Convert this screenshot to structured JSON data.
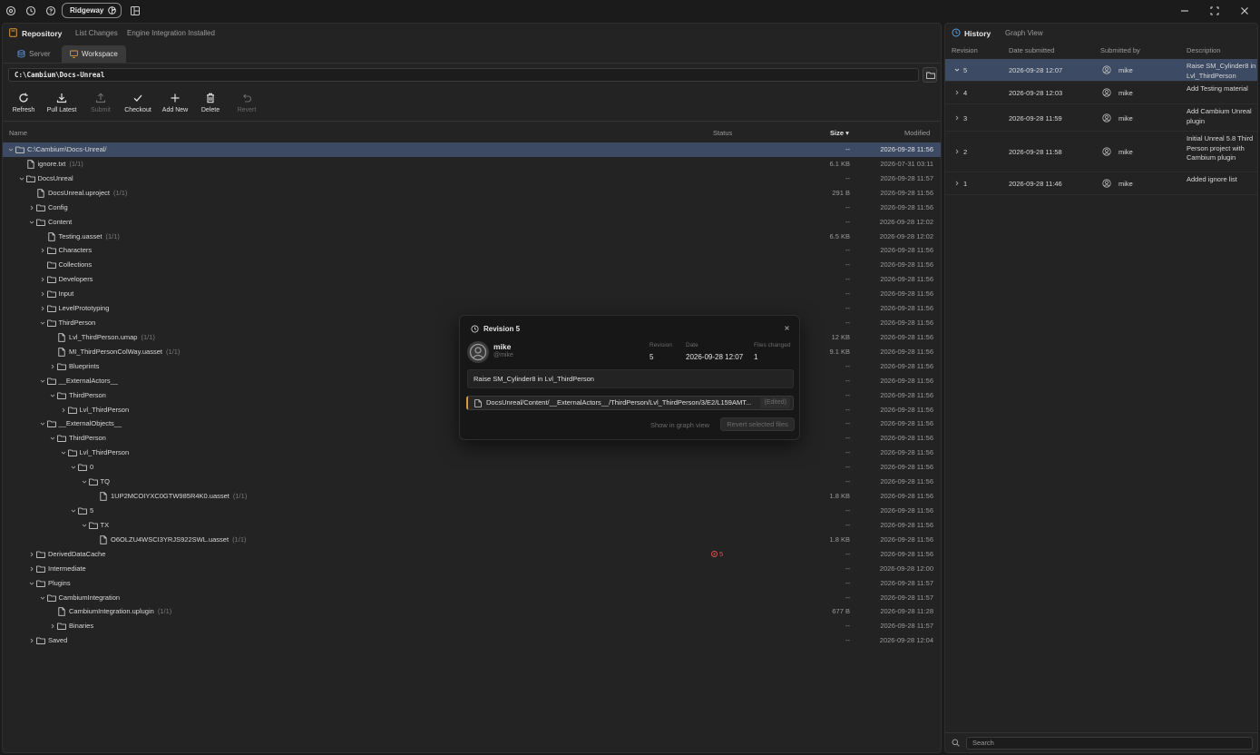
{
  "titlebar": {
    "project_name": "Ridgeway"
  },
  "left_panel": {
    "header": {
      "title": "Repository",
      "tabs": [
        "List Changes",
        "Engine Integration Installed"
      ]
    },
    "subtabs": {
      "server": "Server",
      "workspace": "Workspace",
      "active": "Workspace"
    },
    "path": "C:\\Cambium\\Docs-Unreal",
    "toolbar": {
      "refresh": "Refresh",
      "pull_latest": "Pull Latest",
      "submit": "Submit",
      "checkout": "Checkout",
      "add_new": "Add New",
      "delete": "Delete",
      "revert": "Revert"
    },
    "columns": {
      "name": "Name",
      "status": "Status",
      "size": "Size ▾",
      "modified": "Modified"
    },
    "tree": [
      {
        "name": "C:\\Cambium\\Docs-Unreal/",
        "rev": "",
        "size": "--",
        "modified": "2026-09-28 11:56",
        "type": "folder",
        "depth": 0,
        "expanded": true,
        "selected": true,
        "status": ""
      },
      {
        "name": "ignore.txt",
        "rev": "(1/1)",
        "size": "6.1 KB",
        "modified": "2026-07-31 03:11",
        "type": "file",
        "depth": 1,
        "status": ""
      },
      {
        "name": "DocsUnreal",
        "rev": "",
        "size": "--",
        "modified": "2026-09-28 11:57",
        "type": "folder",
        "depth": 1,
        "expanded": true,
        "status": ""
      },
      {
        "name": "DocsUnreal.uproject",
        "rev": "(1/1)",
        "size": "291 B",
        "modified": "2026-09-28 11:56",
        "type": "file",
        "depth": 2,
        "status": ""
      },
      {
        "name": "Config",
        "rev": "",
        "size": "--",
        "modified": "2026-09-28 11:56",
        "type": "folder",
        "depth": 2,
        "expanded": false,
        "status": ""
      },
      {
        "name": "Content",
        "rev": "",
        "size": "--",
        "modified": "2026-09-28 12:02",
        "type": "folder",
        "depth": 2,
        "expanded": true,
        "status": ""
      },
      {
        "name": "Testing.uasset",
        "rev": "(1/1)",
        "size": "6.5 KB",
        "modified": "2026-09-28 12:02",
        "type": "file",
        "depth": 3,
        "status": ""
      },
      {
        "name": "Characters",
        "rev": "",
        "size": "--",
        "modified": "2026-09-28 11:56",
        "type": "folder",
        "depth": 3,
        "expanded": false,
        "status": ""
      },
      {
        "name": "Collections",
        "rev": "",
        "size": "--",
        "modified": "2026-09-28 11:56",
        "type": "folder",
        "depth": 3,
        "expanded": null,
        "status": ""
      },
      {
        "name": "Developers",
        "rev": "",
        "size": "--",
        "modified": "2026-09-28 11:56",
        "type": "folder",
        "depth": 3,
        "expanded": false,
        "status": ""
      },
      {
        "name": "Input",
        "rev": "",
        "size": "--",
        "modified": "2026-09-28 11:56",
        "type": "folder",
        "depth": 3,
        "expanded": false,
        "status": ""
      },
      {
        "name": "LevelPrototyping",
        "rev": "",
        "size": "--",
        "modified": "2026-09-28 11:56",
        "type": "folder",
        "depth": 3,
        "expanded": false,
        "status": ""
      },
      {
        "name": "ThirdPerson",
        "rev": "",
        "size": "--",
        "modified": "2026-09-28 11:56",
        "type": "folder",
        "depth": 3,
        "expanded": true,
        "status": ""
      },
      {
        "name": "Lvl_ThirdPerson.umap",
        "rev": "(1/1)",
        "size": "12 KB",
        "modified": "2026-09-28 11:56",
        "type": "file",
        "depth": 4,
        "status": ""
      },
      {
        "name": "MI_ThirdPersonColWay.uasset",
        "rev": "(1/1)",
        "size": "9.1 KB",
        "modified": "2026-09-28 11:56",
        "type": "file",
        "depth": 4,
        "status": ""
      },
      {
        "name": "Blueprints",
        "rev": "",
        "size": "--",
        "modified": "2026-09-28 11:56",
        "type": "folder",
        "depth": 4,
        "expanded": false,
        "status": ""
      },
      {
        "name": "__ExternalActors__",
        "rev": "",
        "size": "--",
        "modified": "2026-09-28 11:56",
        "type": "folder",
        "depth": 3,
        "expanded": true,
        "status": ""
      },
      {
        "name": "ThirdPerson",
        "rev": "",
        "size": "--",
        "modified": "2026-09-28 11:56",
        "type": "folder",
        "depth": 4,
        "expanded": true,
        "status": ""
      },
      {
        "name": "Lvl_ThirdPerson",
        "rev": "",
        "size": "--",
        "modified": "2026-09-28 11:56",
        "type": "folder",
        "depth": 5,
        "expanded": false,
        "status": ""
      },
      {
        "name": "__ExternalObjects__",
        "rev": "",
        "size": "--",
        "modified": "2026-09-28 11:56",
        "type": "folder",
        "depth": 3,
        "expanded": true,
        "status": ""
      },
      {
        "name": "ThirdPerson",
        "rev": "",
        "size": "--",
        "modified": "2026-09-28 11:56",
        "type": "folder",
        "depth": 4,
        "expanded": true,
        "status": ""
      },
      {
        "name": "Lvl_ThirdPerson",
        "rev": "",
        "size": "--",
        "modified": "2026-09-28 11:56",
        "type": "folder",
        "depth": 5,
        "expanded": true,
        "status": ""
      },
      {
        "name": "0",
        "rev": "",
        "size": "--",
        "modified": "2026-09-28 11:56",
        "type": "folder",
        "depth": 6,
        "expanded": true,
        "status": ""
      },
      {
        "name": "TQ",
        "rev": "",
        "size": "--",
        "modified": "2026-09-28 11:56",
        "type": "folder",
        "depth": 7,
        "expanded": true,
        "status": ""
      },
      {
        "name": "1UP2MCOIYXC0GTW985R4K0.uasset",
        "rev": "(1/1)",
        "size": "1.8 KB",
        "modified": "2026-09-28 11:56",
        "type": "file",
        "depth": 8,
        "status": ""
      },
      {
        "name": "5",
        "rev": "",
        "size": "--",
        "modified": "2026-09-28 11:56",
        "type": "folder",
        "depth": 6,
        "expanded": true,
        "status": ""
      },
      {
        "name": "TX",
        "rev": "",
        "size": "--",
        "modified": "2026-09-28 11:56",
        "type": "folder",
        "depth": 7,
        "expanded": true,
        "status": ""
      },
      {
        "name": "O6OLZU4WSCI3YRJS922SWL.uasset",
        "rev": "(1/1)",
        "size": "1.8 KB",
        "modified": "2026-09-28 11:56",
        "type": "file",
        "depth": 8,
        "status": ""
      },
      {
        "name": "DerivedDataCache",
        "rev": "",
        "size": "--",
        "modified": "2026-09-28 11:56",
        "type": "folder",
        "depth": 2,
        "expanded": false,
        "status": "5"
      },
      {
        "name": "Intermediate",
        "rev": "",
        "size": "--",
        "modified": "2026-09-28 12:00",
        "type": "folder",
        "depth": 2,
        "expanded": false,
        "status": ""
      },
      {
        "name": "Plugins",
        "rev": "",
        "size": "--",
        "modified": "2026-09-28 11:57",
        "type": "folder",
        "depth": 2,
        "expanded": true,
        "status": ""
      },
      {
        "name": "CambiumIntegration",
        "rev": "",
        "size": "--",
        "modified": "2026-09-28 11:57",
        "type": "folder",
        "depth": 3,
        "expanded": true,
        "status": ""
      },
      {
        "name": "CambiumIntegration.uplugin",
        "rev": "(1/1)",
        "size": "677 B",
        "modified": "2026-09-28 11:28",
        "type": "file",
        "depth": 4,
        "status": ""
      },
      {
        "name": "Binaries",
        "rev": "",
        "size": "--",
        "modified": "2026-09-28 11:57",
        "type": "folder",
        "depth": 4,
        "expanded": false,
        "status": ""
      },
      {
        "name": "Saved",
        "rev": "",
        "size": "--",
        "modified": "2026-09-28 12:04",
        "type": "folder",
        "depth": 2,
        "expanded": false,
        "status": ""
      }
    ]
  },
  "history": {
    "title": "History",
    "graph_tab": "Graph View",
    "columns": {
      "revision": "Revision",
      "date": "Date submitted",
      "by": "Submitted by",
      "desc": "Description"
    },
    "rows": [
      {
        "rev": "5",
        "date": "2026-09-28 12:07",
        "by": "mike",
        "desc": "Raise SM_Cylinder8 in Lvl_ThirdPerson",
        "expanded": true,
        "selected": true
      },
      {
        "rev": "4",
        "date": "2026-09-28 12:03",
        "by": "mike",
        "desc": "Add Testing material",
        "expanded": false
      },
      {
        "rev": "3",
        "date": "2026-09-28 11:59",
        "by": "mike",
        "desc": "Add Cambium Unreal plugin",
        "expanded": false
      },
      {
        "rev": "2",
        "date": "2026-09-28 11:58",
        "by": "mike",
        "desc": "Initial Unreal 5.8 Third Person project with Cambium plugin",
        "expanded": false
      },
      {
        "rev": "1",
        "date": "2026-09-28 11:46",
        "by": "mike",
        "desc": "Added ignore list",
        "expanded": false
      }
    ],
    "search_placeholder": "Search"
  },
  "modal": {
    "title": "Revision 5",
    "user": "mike",
    "handle": "@mike",
    "revision_label": "Revision",
    "revision_value": "5",
    "date_label": "Date",
    "date_value": "2026-09-28 12:07",
    "files_label": "Files changed",
    "files_value": "1",
    "message": "Raise SM_Cylinder8 in Lvl_ThirdPerson",
    "file_path": "DocsUnreal/Content/__ExternalActors__/ThirdPerson/Lvl_ThirdPerson/3/E2/L159AMT...",
    "file_status": "(Edited)",
    "show_graph": "Show in graph view",
    "revert_button": "Revert selected files"
  },
  "colors": {
    "background": "#1b1b1b",
    "panel": "#232323",
    "selection": "#3d4a63",
    "accent_orange": "#d79a3c",
    "status_red": "#d9534f"
  }
}
